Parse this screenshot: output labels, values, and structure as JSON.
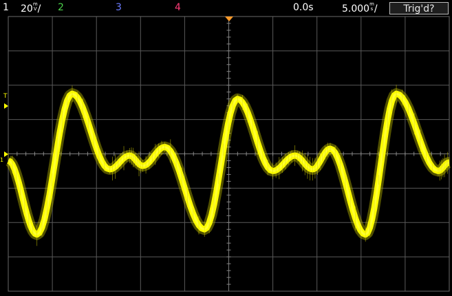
{
  "topbar": {
    "ch1_number": "1",
    "ch1_scale": "20",
    "ch1_unit": "V",
    "ch1_unit_prefix": "m",
    "ch1_div": "/",
    "ch2_label": "2",
    "ch3_label": "3",
    "ch4_label": "4",
    "time_delay": "0.0s",
    "time_scale": "5.000",
    "time_unit": "s",
    "time_unit_prefix": "m",
    "time_div": "/",
    "trigger_status": "Trig'd?"
  },
  "markers": {
    "trigger_level_label": "T",
    "ground_label": "1"
  },
  "colors": {
    "ch1": "#ffff00",
    "ch2": "#4cd24c",
    "ch3": "#6c7cff",
    "ch4": "#ff3c78",
    "trigger_marker": "#ff9a28",
    "grid": "#5a5a5a",
    "text": "#ffffff"
  },
  "scope": {
    "horizontal_divisions": 10,
    "vertical_divisions": 8,
    "waveform": {
      "channel": "1",
      "description_points_divisions": [
        [
          0.0,
          -0.2
        ],
        [
          0.65,
          -2.35
        ],
        [
          1.45,
          1.75
        ],
        [
          2.3,
          -0.45
        ],
        [
          2.75,
          -0.05
        ],
        [
          3.05,
          -0.35
        ],
        [
          3.55,
          0.2
        ],
        [
          4.45,
          -2.2
        ],
        [
          5.2,
          1.6
        ],
        [
          6.0,
          -0.5
        ],
        [
          6.5,
          -0.05
        ],
        [
          6.9,
          -0.45
        ],
        [
          7.3,
          0.15
        ],
        [
          8.1,
          -2.35
        ],
        [
          8.8,
          1.75
        ],
        [
          9.75,
          -0.5
        ],
        [
          10.0,
          -0.25
        ]
      ]
    }
  }
}
